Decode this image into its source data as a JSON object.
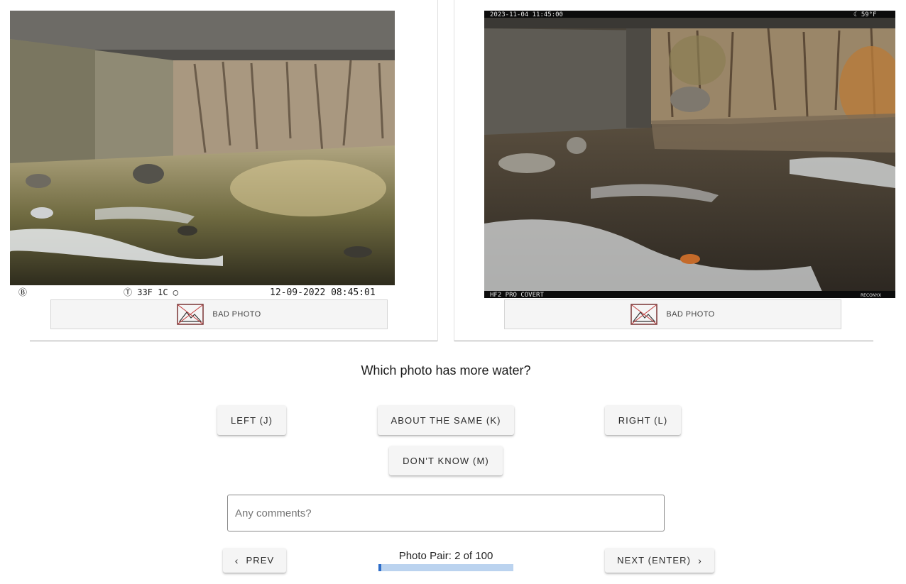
{
  "left_photo": {
    "overlay_left": "Ⓑ",
    "overlay_mid": "Ⓣ  33F   1C  ◯",
    "overlay_right": "12-09-2022 08:45:01",
    "bad_photo_label": "BAD PHOTO"
  },
  "right_photo": {
    "overlay_timestamp": "2023-11-04 11:45:00",
    "overlay_temp": "☾  59°F",
    "overlay_model": "HF2 PRO COVERT",
    "overlay_brand": "RECONYX",
    "bad_photo_label": "BAD PHOTO"
  },
  "question": "Which photo has more water?",
  "choices": {
    "left": "LEFT (J)",
    "same": "ABOUT THE SAME (K)",
    "right": "RIGHT (L)",
    "dont_know": "DON'T KNOW (M)"
  },
  "comments": {
    "placeholder": "Any comments?",
    "value": ""
  },
  "nav": {
    "prev_label": "PREV",
    "next_label": "NEXT (ENTER)",
    "progress_text": "Photo Pair: 2 of 100",
    "progress_fraction": 0.02
  },
  "icons": {
    "bad_photo": "broken-image-icon",
    "prev": "chevron-left-icon",
    "next": "chevron-right-icon"
  },
  "colors": {
    "progress_fill": "#2d6dc9",
    "progress_track": "#bbd3ef",
    "button_bg": "#f5f5f5"
  }
}
